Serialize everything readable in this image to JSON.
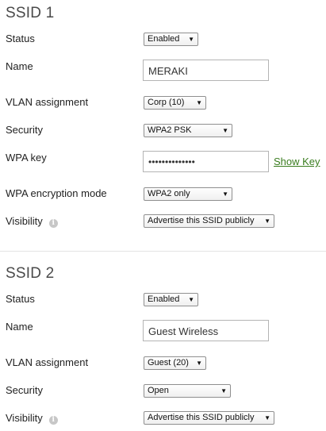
{
  "ssid1": {
    "title": "SSID 1",
    "status": {
      "label": "Status",
      "value": "Enabled"
    },
    "name": {
      "label": "Name",
      "value": "MERAKI"
    },
    "vlan": {
      "label": "VLAN assignment",
      "value": "Corp (10)"
    },
    "security": {
      "label": "Security",
      "value": "WPA2 PSK"
    },
    "wpa_key": {
      "label": "WPA key",
      "value": "••••••••••••••",
      "show_key": "Show Key"
    },
    "wpa_mode": {
      "label": "WPA encryption mode",
      "value": "WPA2 only"
    },
    "visibility": {
      "label": "Visibility",
      "value": "Advertise this SSID publicly"
    }
  },
  "ssid2": {
    "title": "SSID 2",
    "status": {
      "label": "Status",
      "value": "Enabled"
    },
    "name": {
      "label": "Name",
      "value": "Guest Wireless"
    },
    "vlan": {
      "label": "VLAN assignment",
      "value": "Guest (20)"
    },
    "security": {
      "label": "Security",
      "value": "Open"
    },
    "visibility": {
      "label": "Visibility",
      "value": "Advertise this SSID publicly"
    }
  },
  "icons": {
    "dropdown_caret": "chevron-down-icon",
    "info": "info-icon"
  },
  "colors": {
    "link": "#3a7d1f",
    "title": "#4a4a4a"
  }
}
